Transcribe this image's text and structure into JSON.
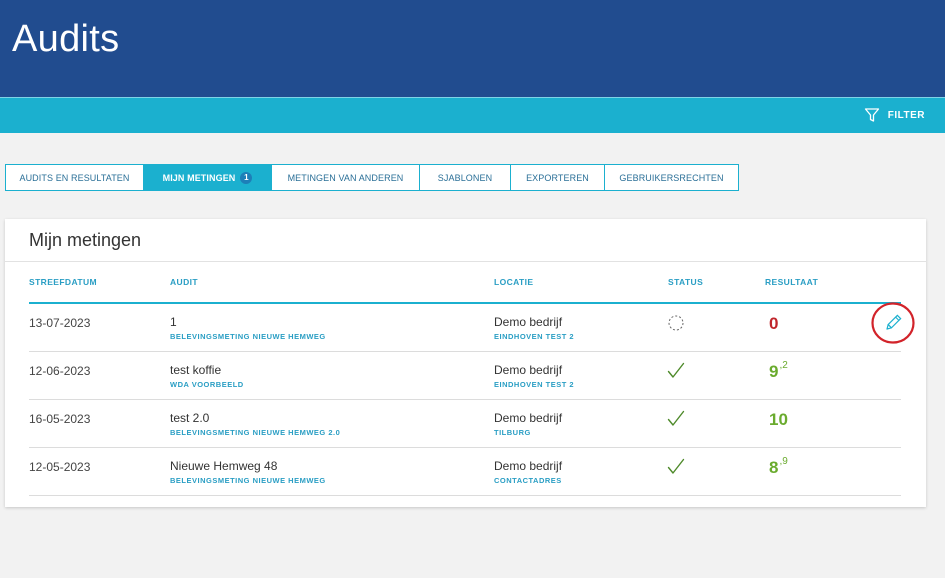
{
  "header": {
    "title": "Audits"
  },
  "filterbar": {
    "filter_label": "FILTER"
  },
  "tabs": [
    {
      "label": "AUDITS EN RESULTATEN",
      "active": false
    },
    {
      "label": "MIJN METINGEN",
      "active": true,
      "badge": "1"
    },
    {
      "label": "METINGEN VAN ANDEREN",
      "active": false
    },
    {
      "label": "SJABLONEN",
      "active": false
    },
    {
      "label": "EXPORTEREN",
      "active": false
    },
    {
      "label": "GEBRUIKERSRECHTEN",
      "active": false
    }
  ],
  "card": {
    "title": "Mijn metingen",
    "columns": {
      "date": "STREEFDATUM",
      "audit": "AUDIT",
      "location": "LOCATIE",
      "status": "STATUS",
      "result": "RESULTAAT"
    },
    "rows": [
      {
        "date": "13-07-2023",
        "audit": "1",
        "template": "BELEVINGSMETING NIEUWE HEMWEG",
        "location": "Demo bedrijf",
        "sublocation": "EINDHOVEN TEST 2",
        "status": "in-progress",
        "result_int": "0",
        "result_dec": "",
        "editable": true
      },
      {
        "date": "12-06-2023",
        "audit": "test koffie",
        "template": "WDA VOORBEELD",
        "location": "Demo bedrijf",
        "sublocation": "EINDHOVEN TEST 2",
        "status": "done",
        "result_int": "9",
        "result_dec": ",2",
        "editable": false
      },
      {
        "date": "16-05-2023",
        "audit": "test 2.0",
        "template": "BELEVINGSMETING NIEUWE HEMWEG 2.0",
        "location": "Demo bedrijf",
        "sublocation": "TILBURG",
        "status": "done",
        "result_int": "10",
        "result_dec": "",
        "editable": false
      },
      {
        "date": "12-05-2023",
        "audit": "Nieuwe Hemweg 48",
        "template": "BELEVINGSMETING NIEUWE HEMWEG",
        "location": "Demo bedrijf",
        "sublocation": "CONTACTADRES",
        "status": "done",
        "result_int": "8",
        "result_dec": ",9",
        "editable": false
      }
    ]
  },
  "colors": {
    "header": "#214c8f",
    "accent": "#1bb0cf",
    "result_bad": "#c0262c",
    "result_good": "#6aab2e",
    "highlight_circle": "#d2232a"
  },
  "icons": {
    "filter": "filter-icon",
    "status_in_progress": "dashed-circle-icon",
    "status_done": "checkmark-icon",
    "edit": "pencil-icon"
  }
}
